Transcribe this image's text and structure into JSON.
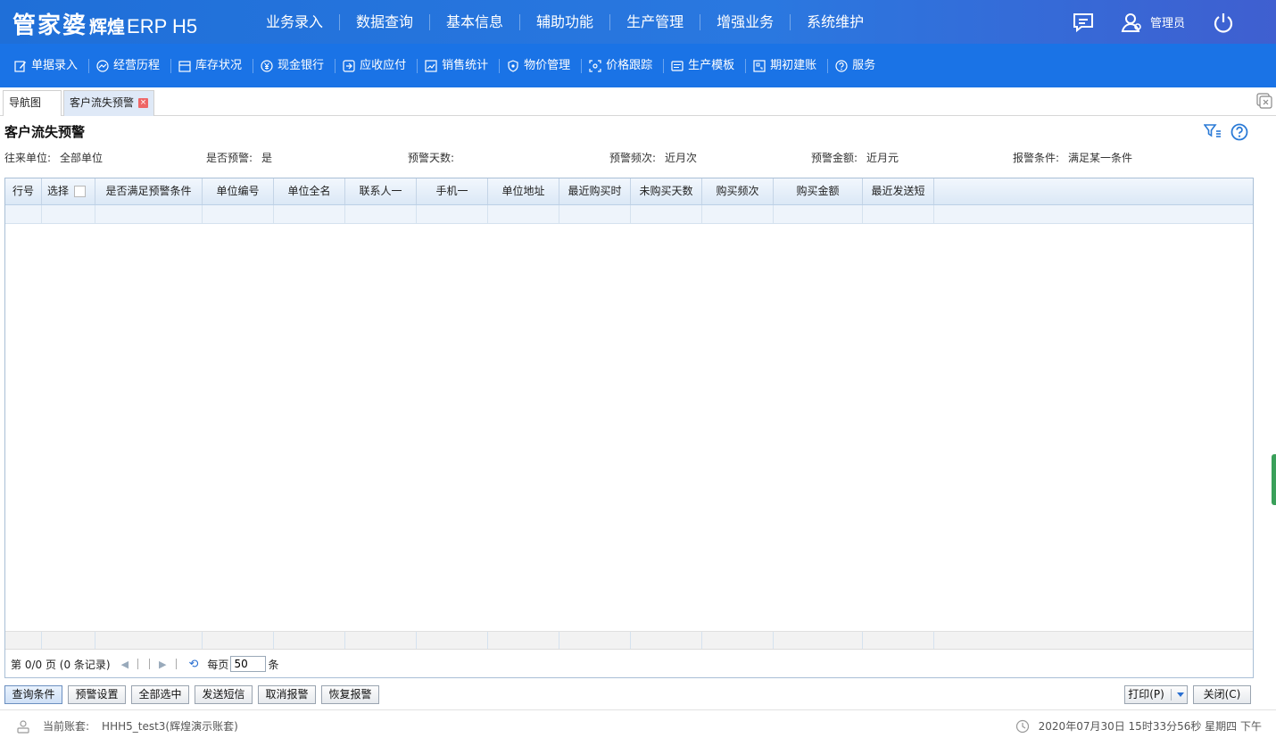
{
  "app": {
    "logo_main": "管家婆",
    "logo_sub": "辉煌",
    "logo_product": "ERP H5",
    "main_nav": [
      "业务录入",
      "数据查询",
      "基本信息",
      "辅助功能",
      "生产管理",
      "增强业务",
      "系统维护"
    ],
    "user_name": "管理员"
  },
  "toolbar": {
    "items": [
      {
        "label": "单据录入",
        "icon": "edit-icon"
      },
      {
        "label": "经营历程",
        "icon": "trend-icon"
      },
      {
        "label": "库存状况",
        "icon": "stock-icon"
      },
      {
        "label": "现金银行",
        "icon": "yuan-icon"
      },
      {
        "label": "应收应付",
        "icon": "receivable-icon"
      },
      {
        "label": "销售统计",
        "icon": "sales-chart-icon"
      },
      {
        "label": "物价管理",
        "icon": "price-shield-icon"
      },
      {
        "label": "价格跟踪",
        "icon": "track-icon"
      },
      {
        "label": "生产模板",
        "icon": "template-icon"
      },
      {
        "label": "期初建账",
        "icon": "ledger-icon"
      },
      {
        "label": "服务",
        "icon": "help-circle-icon"
      }
    ]
  },
  "tabs": {
    "nav": "导航图",
    "active": "客户流失预警"
  },
  "page": {
    "title": "客户流失预警",
    "filters": {
      "unit_label": "往来单位:",
      "unit_value": "全部单位",
      "warn_label": "是否预警:",
      "warn_value": "是",
      "days_label": "预警天数:",
      "days_value": "",
      "freq_label": "预警频次:",
      "freq_value": "近月次",
      "amount_label": "预警金额:",
      "amount_value": "近月元",
      "cond_label": "报警条件:",
      "cond_value": "满足某一条件"
    }
  },
  "grid": {
    "columns": [
      "行号",
      "选择",
      "是否满足预警条件",
      "单位编号",
      "单位全名",
      "联系人一",
      "手机一",
      "单位地址",
      "最近购买时",
      "未购买天数",
      "购买频次",
      "购买金额",
      "最近发送短"
    ],
    "rows": []
  },
  "pager": {
    "info": "第 0/0 页 (0 条记录)",
    "per_page_label": "每页",
    "per_page_value": "50",
    "unit": "条"
  },
  "buttons": {
    "query": "查询条件",
    "warn_settings": "预警设置",
    "select_all": "全部选中",
    "send_sms": "发送短信",
    "cancel_alarm": "取消报警",
    "restore_alarm": "恢复报警",
    "print": "打印(P)",
    "close": "关闭(C)"
  },
  "status": {
    "account_label": "当前账套:",
    "account_value": "HHH5_test3(辉煌演示账套)",
    "datetime": "2020年07月30日 15时33分56秒 星期四 下午"
  },
  "colors": {
    "header_blue": "#1f6fd8",
    "toolbar_blue": "#1a73e6",
    "grid_header": "#dbe8f6"
  }
}
